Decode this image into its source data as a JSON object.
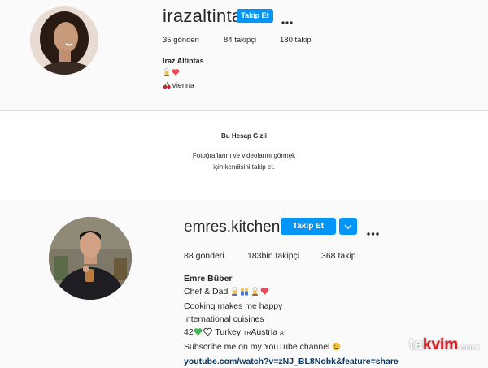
{
  "profile1": {
    "username": "irazaltintas",
    "follow_label": "Takip Et",
    "stats": {
      "posts": "35",
      "posts_label": "gönderi",
      "followers": "84",
      "followers_label": "takipçi",
      "following": "180",
      "following_label": "takip"
    },
    "full_name": "Iraz Altintas",
    "location": "Vienna"
  },
  "private_notice": {
    "title": "Bu Hesap Gizli",
    "line1": "Fotoğraflarını ve videolarını görmek",
    "line2": "için kendisini takip et."
  },
  "profile2": {
    "username": "emres.kitchen",
    "follow_label": "Takip Et",
    "stats": {
      "posts": "88",
      "posts_label": "gönderi",
      "followers": "183bin",
      "followers_label": "takipçi",
      "following": "368",
      "following_label": "takip"
    },
    "full_name": "Emre Büber",
    "bio_line1": "Chef & Dad",
    "bio_line2": "Cooking makes me happy",
    "bio_line3": "International cuisines",
    "bio_line4_num": "42",
    "bio_line4_tr": "Turkey",
    "bio_line4_tr_flag": "TR",
    "bio_line4_at": "Austria",
    "bio_line4_at_flag": "AT",
    "bio_line5": "Subscribe me on my YouTube channel",
    "link": "youtube.com/watch?v=zNJ_BL8Nobk&feature=share"
  },
  "watermark": {
    "part1": "ta",
    "part2": "kvim",
    "suffix": ".com.tr"
  },
  "colors": {
    "accent": "#0095f6",
    "link": "#00376b",
    "heart_red": "#ed4956",
    "heart_green": "#3fb950"
  }
}
